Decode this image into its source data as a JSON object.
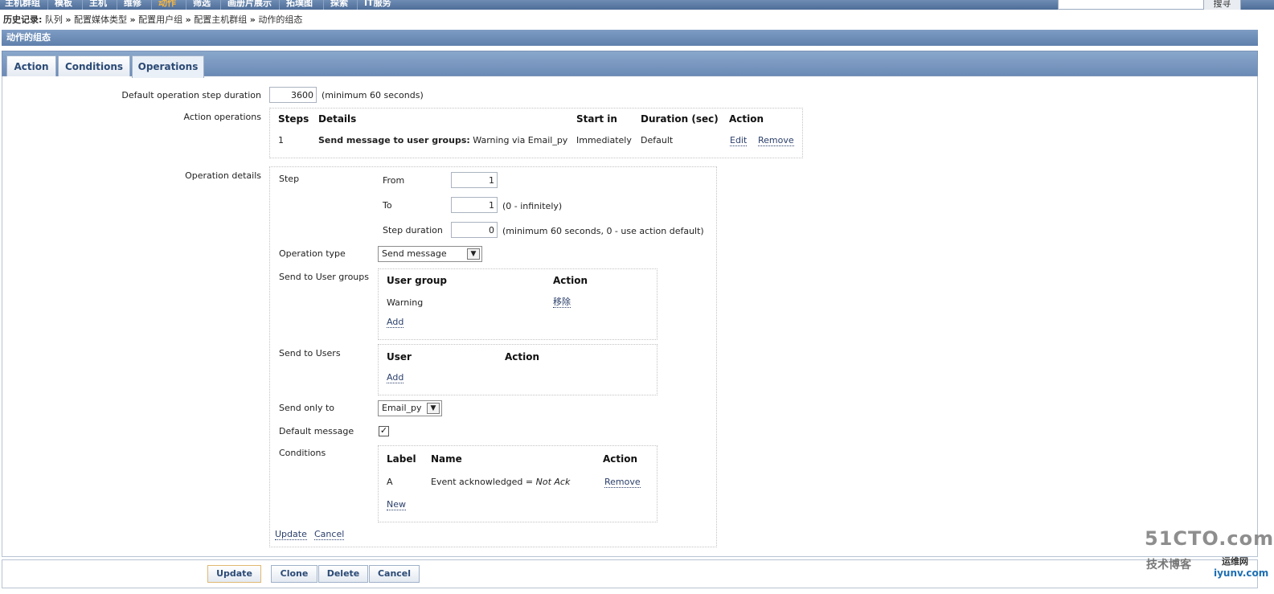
{
  "topnav": {
    "items": [
      "主机群组",
      "模板",
      "主机",
      "维修",
      "动作",
      "筛选",
      "画册片展示",
      "拓璞图",
      "探索",
      "IT服务"
    ],
    "active": "动作",
    "search_button": "搜寻"
  },
  "breadcrumb": {
    "label": "历史记录:",
    "items": [
      "队列",
      "配置媒体类型",
      "配置用户组",
      "配置主机群组",
      "动作的组态"
    ],
    "separator": "»"
  },
  "title": "动作的组态",
  "tabs": [
    "Action",
    "Conditions",
    "Operations"
  ],
  "active_tab": "Operations",
  "form": {
    "default_step_duration_label": "Default operation step duration",
    "default_step_duration_value": "3600",
    "default_step_duration_hint": "(minimum 60 seconds)",
    "action_operations_label": "Action operations",
    "operations_table": {
      "headers": [
        "Steps",
        "Details",
        "Start in",
        "Duration (sec)",
        "Action"
      ],
      "rows": [
        {
          "steps": "1",
          "details_bold": "Send message to user groups:",
          "details_rest": " Warning via Email_py",
          "start_in": "Immediately",
          "duration": "Default",
          "edit": "Edit",
          "remove": "Remove"
        }
      ]
    },
    "operation_details_label": "Operation details",
    "step_label": "Step",
    "from_label": "From",
    "from_value": "1",
    "to_label": "To",
    "to_value": "1",
    "to_hint": "(0 - infinitely)",
    "step_duration_label": "Step duration",
    "step_duration_value": "0",
    "step_duration_hint": "(minimum 60 seconds, 0 - use action default)",
    "operation_type_label": "Operation type",
    "operation_type_value": "Send message",
    "send_to_groups_label": "Send to User groups",
    "groups_table": {
      "headers": [
        "User group",
        "Action"
      ],
      "rows": [
        {
          "group": "Warning",
          "action": "移除"
        }
      ],
      "add": "Add"
    },
    "send_to_users_label": "Send to Users",
    "users_table": {
      "headers": [
        "User",
        "Action"
      ],
      "add": "Add"
    },
    "send_only_to_label": "Send only to",
    "send_only_to_value": "Email_py",
    "default_message_label": "Default message",
    "default_message_checked": true,
    "conditions_label": "Conditions",
    "conditions_table": {
      "headers": [
        "Label",
        "Name",
        "Action"
      ],
      "rows": [
        {
          "label": "A",
          "name_prefix": "Event acknowledged = ",
          "name_value": "Not Ack",
          "action": "Remove"
        }
      ],
      "new": "New"
    },
    "update_link": "Update",
    "cancel_link": "Cancel"
  },
  "footer_buttons": [
    "Update",
    "Clone",
    "Delete",
    "Cancel"
  ],
  "watermark": {
    "line1": "51CTO.com",
    "line2": "技术博客",
    "line3": "iyunv.com",
    "line4": "运维网"
  }
}
